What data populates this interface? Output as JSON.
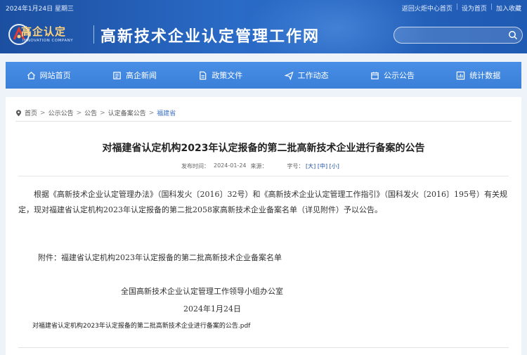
{
  "topbar": {
    "date": "2024年1月24日 星期三",
    "links": [
      "返回火炬中心首页",
      "设为首页",
      "加入收藏"
    ]
  },
  "logo": {
    "text": "高企认定",
    "subtitle": "INNOVATION COMPANY"
  },
  "site_title": "高新技术企业认定管理工作网",
  "search": {
    "placeholder": "",
    "icon": "search-icon"
  },
  "nav": [
    {
      "label": "网站首页",
      "icon": "home-icon"
    },
    {
      "label": "高企新闻",
      "icon": "news-icon"
    },
    {
      "label": "政策文件",
      "icon": "document-icon"
    },
    {
      "label": "工作动态",
      "icon": "send-icon"
    },
    {
      "label": "公示公告",
      "icon": "notice-icon"
    },
    {
      "label": "统计数据",
      "icon": "chart-icon"
    }
  ],
  "breadcrumb": [
    "首页",
    "公示公告",
    "公告",
    "认定备案公告",
    "福建省"
  ],
  "article": {
    "title": "对福建省认定机构2023年认定报备的第二批高新技术企业进行备案的公告",
    "publish_label": "发布时间：",
    "publish_date": "2024-01-24",
    "source_label": "来源：",
    "font_size_label": "字号：",
    "font_sizes": [
      "[大]",
      "[中]",
      "[小]"
    ],
    "paragraph1": "根据《高新技术企业认定管理办法》（国科发火〔2016〕32号）和《高新技术企业认定管理工作指引》（国科发火〔2016〕195号）有关规定，现对福建省认定机构2023年认定报备的第二批2058家高新技术企业备案名单（详见附件）予以公告。",
    "paragraph2": "附件：福建省认定机构2023年认定报备的第二批高新技术企业备案名单",
    "signature_org": "全国高新技术企业认定管理工作领导小组办公室",
    "signature_date": "2024年1月24日",
    "attachment_file": "对福建省认定机构2023年认定报备的第二批高新技术企业进行备案的公告.pdf"
  },
  "colors": {
    "header": "#1c4fa0",
    "nav": "#3a7fd8",
    "accent": "#3a6fc4",
    "logo_text": "#ffd27a"
  }
}
